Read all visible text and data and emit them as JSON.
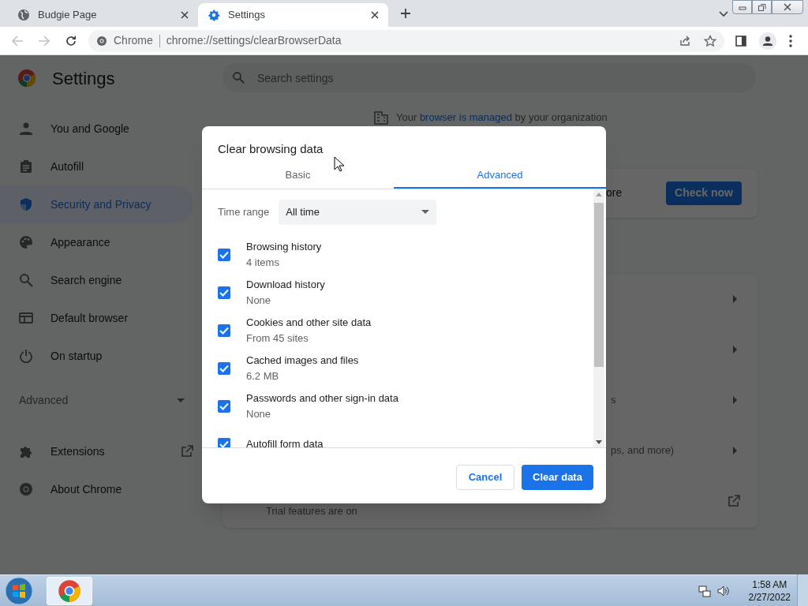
{
  "browser": {
    "tabs": [
      {
        "title": "Budgie Page",
        "selected": false
      },
      {
        "title": "Settings",
        "selected": true
      }
    ],
    "address_bar": {
      "site_label": "Chrome",
      "url": "chrome://settings/clearBrowserData"
    }
  },
  "settings": {
    "title": "Settings",
    "sidebar": {
      "items": [
        {
          "label": "You and Google",
          "selected": false
        },
        {
          "label": "Autofill",
          "selected": false
        },
        {
          "label": "Security and Privacy",
          "selected": true
        },
        {
          "label": "Appearance",
          "selected": false
        },
        {
          "label": "Search engine",
          "selected": false
        },
        {
          "label": "Default browser",
          "selected": false
        },
        {
          "label": "On startup",
          "selected": false
        }
      ],
      "advanced_label": "Advanced",
      "bottom_items": [
        {
          "label": "Extensions"
        },
        {
          "label": "About Chrome"
        }
      ]
    },
    "search_placeholder": "Search settings",
    "managed_notice": {
      "before": "Your",
      "link": "browser is managed",
      "after": "by your organization"
    },
    "safety_card": {
      "text_fragment": "ore",
      "button": "Check now"
    },
    "privacy_rows": [
      {
        "text_fragment": ""
      },
      {
        "text_fragment": ""
      },
      {
        "text_fragment": "s"
      },
      {
        "text_fragment": "ps, and more)"
      }
    ],
    "trial_text": "Trial features are on"
  },
  "dialog": {
    "title": "Clear browsing data",
    "tabs": [
      {
        "label": "Basic",
        "selected": false
      },
      {
        "label": "Advanced",
        "selected": true
      }
    ],
    "time_range": {
      "label": "Time range",
      "value": "All time"
    },
    "items": [
      {
        "label": "Browsing history",
        "detail": "4 items",
        "checked": true
      },
      {
        "label": "Download history",
        "detail": "None",
        "checked": true
      },
      {
        "label": "Cookies and other site data",
        "detail": "From 45 sites",
        "checked": true
      },
      {
        "label": "Cached images and files",
        "detail": "6.2 MB",
        "checked": true
      },
      {
        "label": "Passwords and other sign-in data",
        "detail": "None",
        "checked": true
      },
      {
        "label": "Autofill form data",
        "checked": true
      }
    ],
    "buttons": {
      "cancel": "Cancel",
      "confirm": "Clear data"
    }
  },
  "taskbar": {
    "time": "1:58 AM",
    "date": "2/27/2022"
  }
}
